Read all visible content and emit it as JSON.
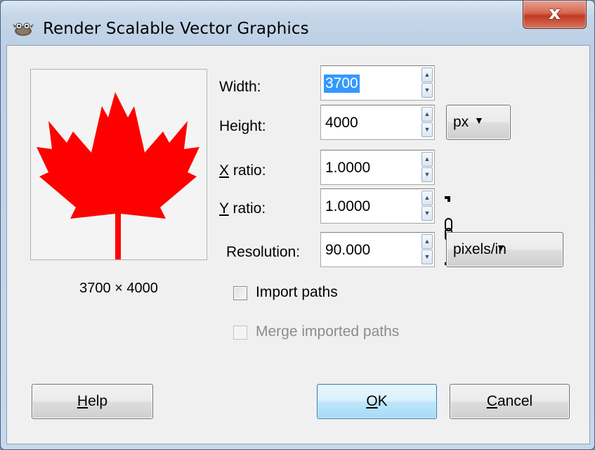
{
  "dialog": {
    "title": "Render Scalable Vector Graphics",
    "close_glyph": "x"
  },
  "preview": {
    "image": "canada-maple-leaf",
    "leaf_color": "#ff0000",
    "dimensions": "3700 × 4000"
  },
  "fields": {
    "width": {
      "label": "Width:",
      "value": "3700"
    },
    "height": {
      "label": "Height:",
      "value": "4000"
    },
    "x_ratio": {
      "label_mnemonic": "X",
      "label_rest": " ratio:",
      "value": "1.0000"
    },
    "y_ratio": {
      "label_mnemonic": "Y",
      "label_rest": " ratio:",
      "value": "1.0000"
    },
    "resolution": {
      "label": "Resolution:",
      "value": "90.000"
    }
  },
  "unit_select": {
    "value": "px"
  },
  "resolution_unit_select": {
    "value": "pixels/in"
  },
  "chain_icon": "chain-link-icon",
  "options": {
    "import_paths": {
      "label": "Import paths",
      "checked": false,
      "enabled": true
    },
    "merge_paths": {
      "label": "Merge imported paths",
      "checked": false,
      "enabled": false
    }
  },
  "buttons": {
    "help": {
      "mnemonic": "H",
      "rest": "elp"
    },
    "ok": {
      "mnemonic": "O",
      "rest": "K"
    },
    "cancel": {
      "mnemonic": "C",
      "rest": "ancel"
    }
  }
}
